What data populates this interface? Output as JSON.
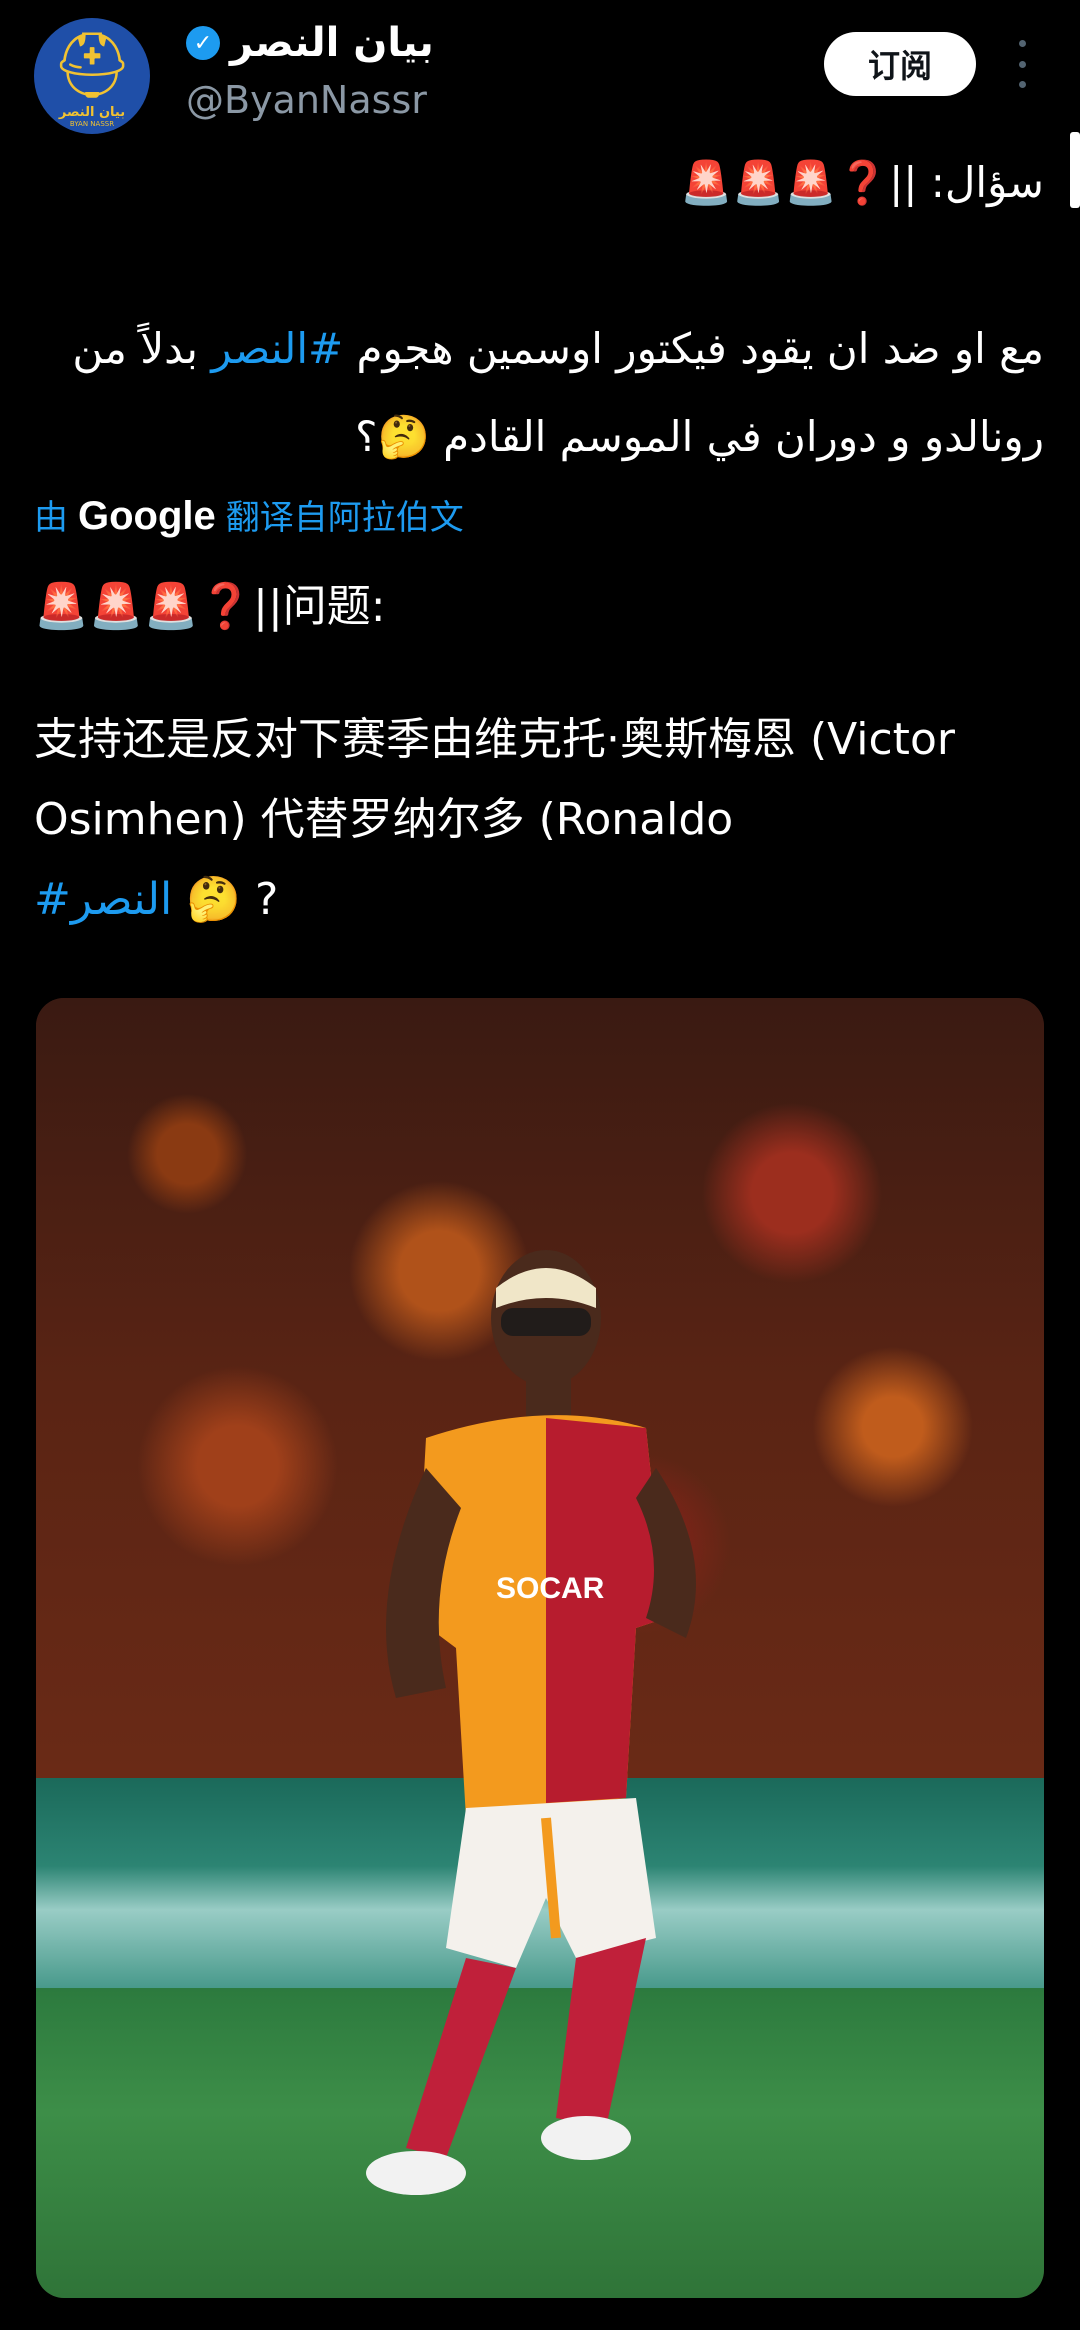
{
  "header": {
    "display_name": "بيان النصر",
    "verified_mark": "✓",
    "handle": "@ByanNassr",
    "subscribe_label": "订阅",
    "avatar_text": "بيان النصر",
    "avatar_subtext": "BYAN NASSR",
    "colors": {
      "accent": "#1d9bf0",
      "avatar_bg": "#1f4fa8",
      "avatar_fg": "#f1c232"
    }
  },
  "post": {
    "arabic_heading": "سؤال: ||❓🚨🚨🚨",
    "arabic_body_before_tag": "مع او ضد ان يقود فيكتور اوسمين هجوم ",
    "arabic_hashtag": "#النصر",
    "arabic_body_after_tag": " بدلاً من رونالدو و دوران في الموسم القادم 🤔؟",
    "translation": {
      "prefix": "由",
      "provider": "Google",
      "suffix": "翻译自阿拉伯文"
    },
    "chinese_heading": "🚨🚨🚨❓||问题:",
    "chinese_body": "支持还是反对下赛季由维克托·奥斯梅恩 (Victor Osimhen) 代替罗纳尔多 (Ronaldo",
    "chinese_hashtag": "#النصر",
    "chinese_tail": "🤔 ?"
  },
  "media": {
    "jersey_sponsor": "SOCAR"
  }
}
